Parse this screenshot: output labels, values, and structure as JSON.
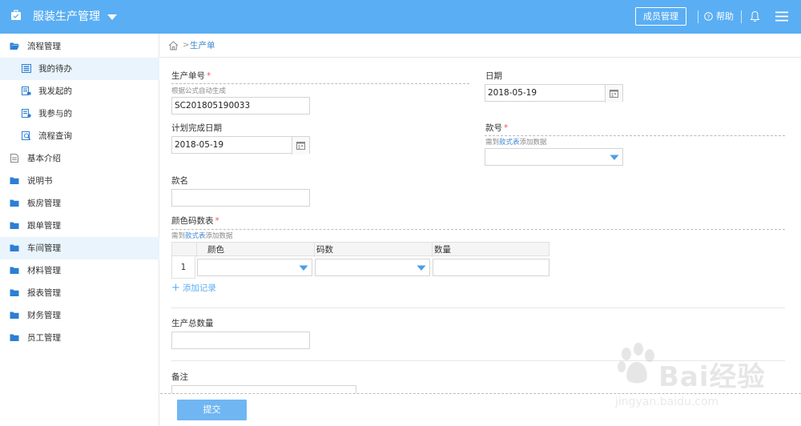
{
  "header": {
    "app_title": "服装生产管理",
    "members_button": "成员管理",
    "help_label": "帮助",
    "bg_color": "#5aaef3"
  },
  "sidebar": {
    "items": [
      {
        "label": "流程管理",
        "icon": "folder-open-icon"
      },
      {
        "label": "我的待办",
        "icon": "todo-list-icon"
      },
      {
        "label": "我发起的",
        "icon": "initiated-icon"
      },
      {
        "label": "我参与的",
        "icon": "participated-icon"
      },
      {
        "label": "流程查询",
        "icon": "process-search-icon"
      },
      {
        "label": "基本介绍",
        "icon": "document-icon"
      },
      {
        "label": "说明书",
        "icon": "folder-icon"
      },
      {
        "label": "板房管理",
        "icon": "folder-icon"
      },
      {
        "label": "跟单管理",
        "icon": "folder-icon"
      },
      {
        "label": "车间管理",
        "icon": "folder-icon"
      },
      {
        "label": "材料管理",
        "icon": "folder-icon"
      },
      {
        "label": "报表管理",
        "icon": "folder-icon"
      },
      {
        "label": "财务管理",
        "icon": "folder-icon"
      },
      {
        "label": "员工管理",
        "icon": "folder-icon"
      }
    ]
  },
  "breadcrumb": {
    "separator": ">",
    "current": "生产单"
  },
  "form": {
    "required_mark": "*",
    "order_no": {
      "label": "生产单号",
      "hint": "根据公式自动生成",
      "value": "SC201805190033"
    },
    "date": {
      "label": "日期",
      "value": "2018-05-19"
    },
    "planned_date": {
      "label": "计划完成日期",
      "value": "2018-05-19"
    },
    "style_no": {
      "label": "款号",
      "hint_prefix": "需到",
      "hint_link": "款式表",
      "hint_suffix": "添加数据",
      "value": ""
    },
    "style_name": {
      "label": "款名",
      "value": ""
    },
    "color_size_table": {
      "label": "颜色码数表",
      "hint_prefix": "需到",
      "hint_link": "款式表",
      "hint_suffix": "添加数据",
      "columns": [
        "颜色",
        "码数",
        "数量"
      ],
      "rows": [
        {
          "index": "1",
          "color": "",
          "size": "",
          "qty": ""
        }
      ],
      "add_record": "添加记录"
    },
    "total_qty": {
      "label": "生产总数量",
      "value": ""
    },
    "remark": {
      "label": "备注",
      "value": ""
    }
  },
  "footer": {
    "submit": "提交"
  },
  "watermark": {
    "text": "Bai经验",
    "url": "jingyan.baidu.com"
  }
}
